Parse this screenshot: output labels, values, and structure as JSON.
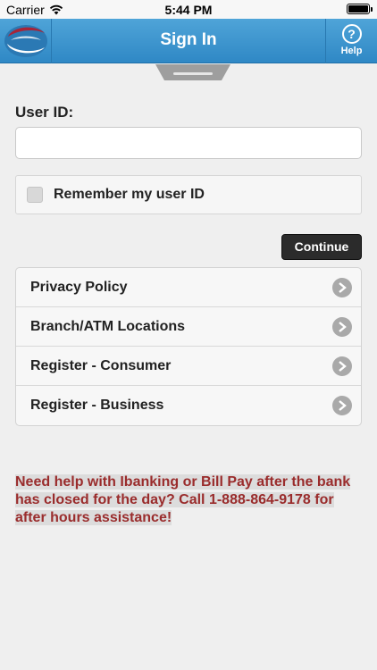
{
  "status_bar": {
    "carrier": "Carrier",
    "time": "5:44 PM"
  },
  "header": {
    "title": "Sign In",
    "help_label": "Help",
    "help_icon": "?",
    "colors": {
      "background": "#3a94cf",
      "text": "#ffffff"
    }
  },
  "form": {
    "userid_label": "User ID:",
    "userid_value": "",
    "userid_placeholder": "",
    "remember_label": "Remember my user ID",
    "remember_checked": false,
    "continue_label": "Continue"
  },
  "links": [
    {
      "label": "Privacy Policy",
      "icon": "chevron-right-icon"
    },
    {
      "label": "Branch/ATM Locations",
      "icon": "chevron-right-icon"
    },
    {
      "label": "Register - Consumer",
      "icon": "chevron-right-icon"
    },
    {
      "label": "Register - Business",
      "icon": "chevron-right-icon"
    }
  ],
  "notice": {
    "text": "Need help with Ibanking or Bill Pay after the bank has closed for the day? Call 1-888-864-9178 for after hours assistance!",
    "color": "#9a2c2c"
  }
}
